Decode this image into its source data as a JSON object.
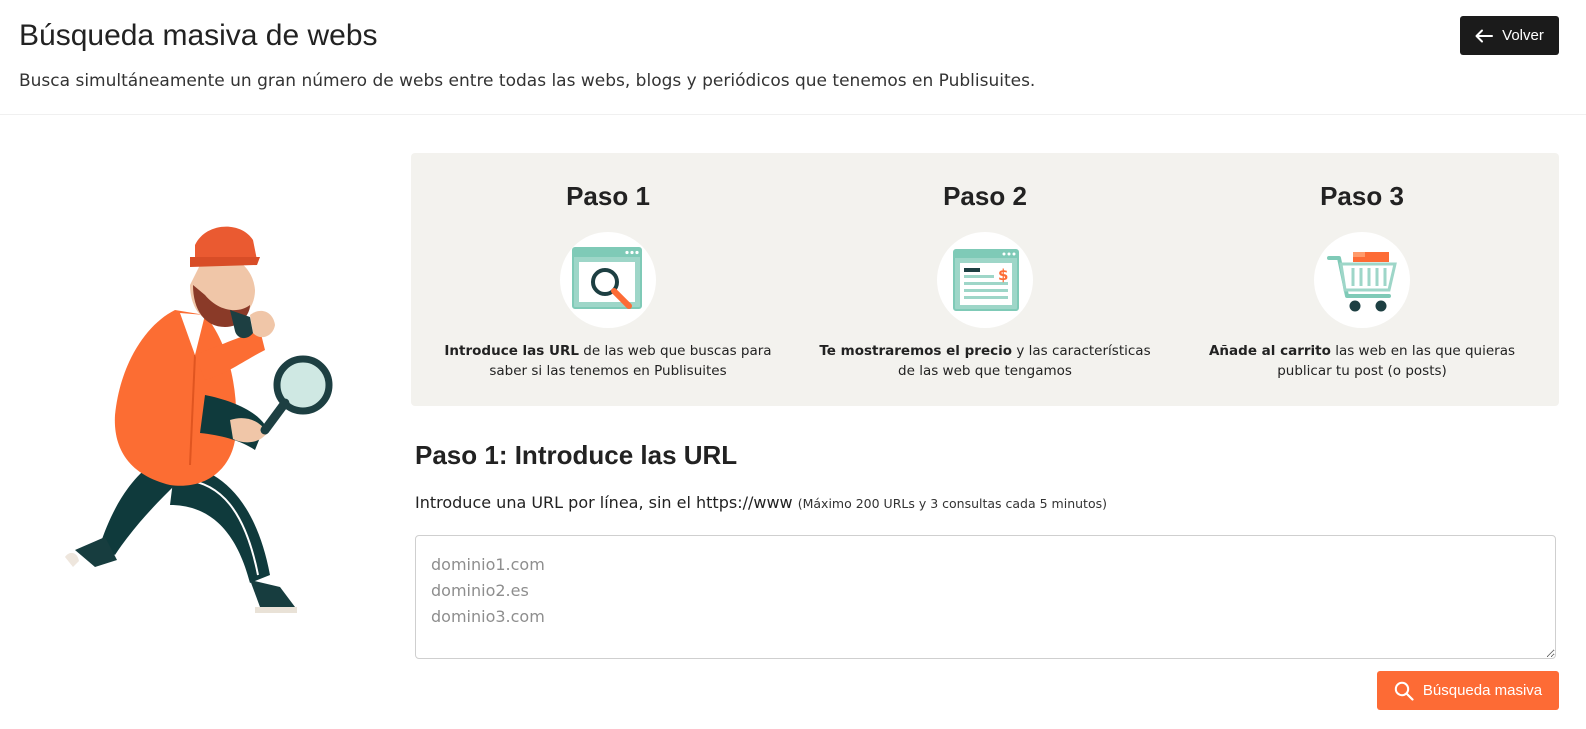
{
  "header": {
    "title": "Búsqueda masiva de webs",
    "subtitle": "Busca simultáneamente un gran número de webs entre todas las webs, blogs y periódicos que tenemos en Publisuites.",
    "back_label": "Volver",
    "back_icon": "arrow-left-icon"
  },
  "steps": [
    {
      "title": "Paso 1",
      "icon": "browser-search-icon",
      "bold": "Introduce las URL",
      "rest": " de las web que buscas para saber si las tenemos en Publisuites"
    },
    {
      "title": "Paso 2",
      "icon": "price-page-icon",
      "bold": "Te mostraremos el precio",
      "rest": " y las características de las web que tengamos"
    },
    {
      "title": "Paso 3",
      "icon": "shopping-cart-icon",
      "bold": "Añade al carrito",
      "rest": " las web en las que quieras publicar tu post (o posts)"
    }
  ],
  "form": {
    "title": "Paso 1: Introduce las URL",
    "instructions": "Introduce una URL por línea, sin el https://www",
    "limits": "(Máximo 200 URLs y 3 consultas cada 5 minutos)",
    "placeholder": "dominio1.com\ndominio2.es\ndominio3.com",
    "value": "",
    "submit_label": "Búsqueda masiva"
  },
  "colors": {
    "accent": "#fd6b35",
    "dark_button": "#1b1b1b",
    "panel_bg": "#f3f2ee",
    "icon_teal": "#7fcab7",
    "icon_dark": "#1d3f42"
  }
}
